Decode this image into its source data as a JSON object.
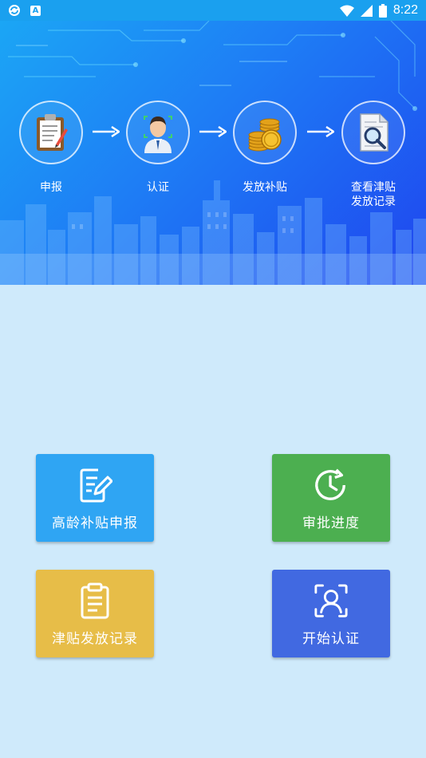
{
  "status_bar": {
    "time": "8:22",
    "icons": [
      "sync-icon",
      "a-notification-icon",
      "wifi-icon",
      "signal-icon",
      "battery-icon"
    ],
    "battery_level": "8"
  },
  "banner": {
    "steps": [
      {
        "label": "申报",
        "icon": "clipboard-icon"
      },
      {
        "label": "认证",
        "icon": "face-verify-icon"
      },
      {
        "label": "发放补贴",
        "icon": "coins-icon"
      },
      {
        "label": "查看津贴\n发放记录",
        "icon": "document-search-icon"
      }
    ]
  },
  "tiles": [
    {
      "label": "高龄补贴申报",
      "color": "#2fa5f3",
      "icon": "edit-document-icon"
    },
    {
      "label": "审批进度",
      "color": "#4caf50",
      "icon": "clock-refresh-icon"
    },
    {
      "label": "津贴发放记录",
      "color": "#e7bd48",
      "icon": "clipboard-list-icon"
    },
    {
      "label": "开始认证",
      "color": "#4169e1",
      "icon": "face-scan-icon"
    }
  ],
  "colors": {
    "background": "#cfeafb",
    "status_bar": "#1aa0ef",
    "banner_start": "#1ba6f5",
    "banner_end": "#1f45ef"
  }
}
